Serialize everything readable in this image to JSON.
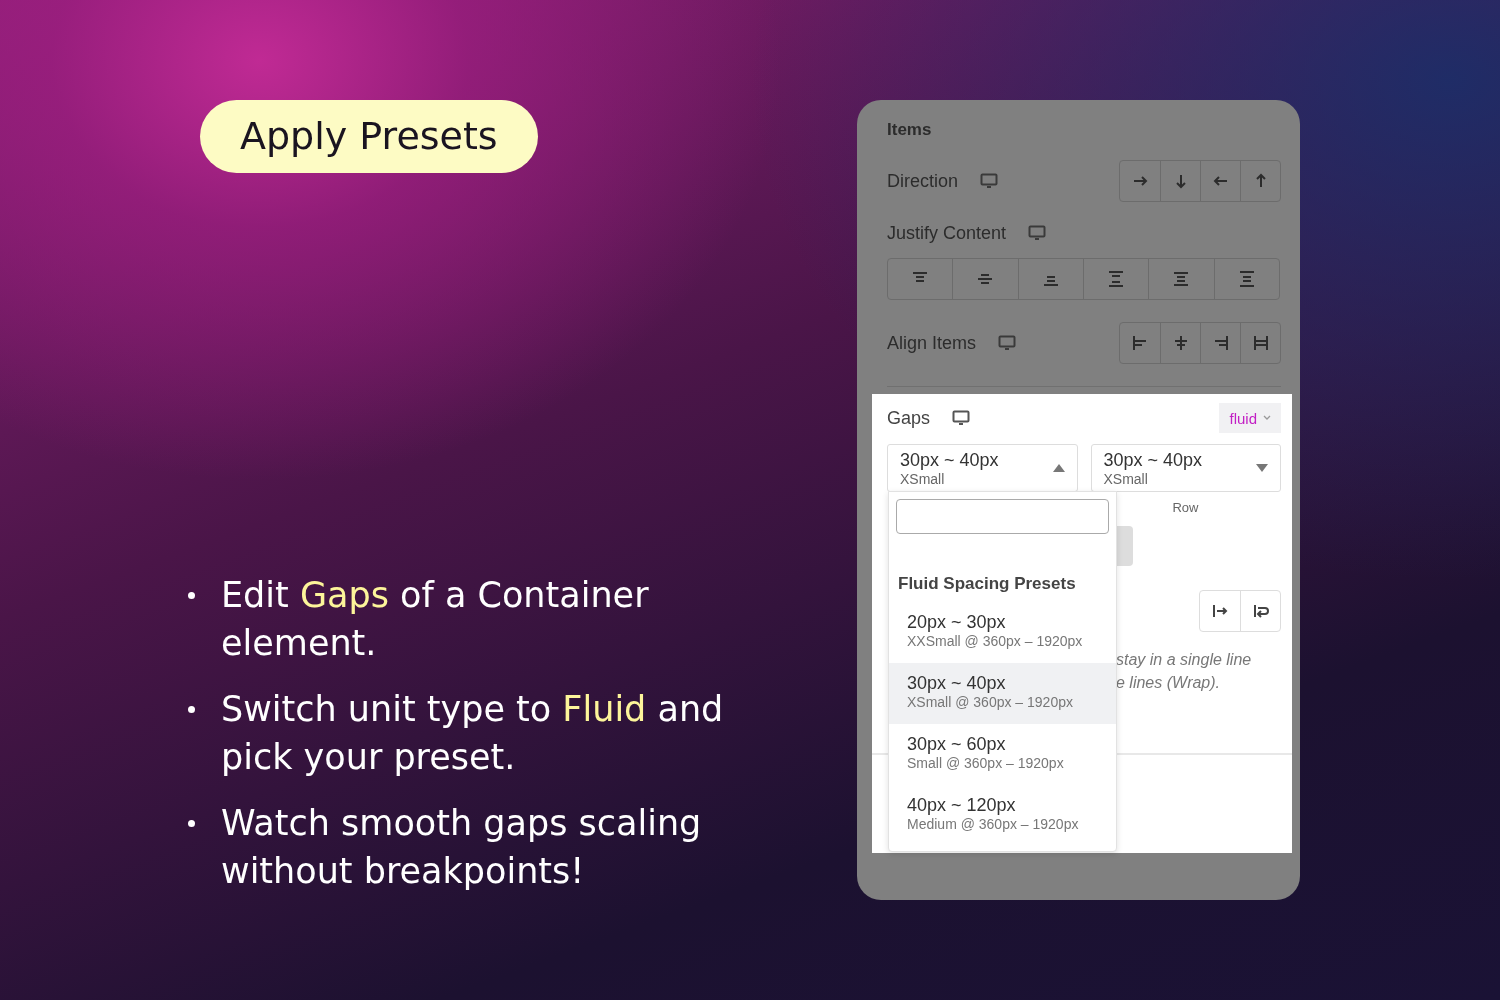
{
  "promo": {
    "title": "Apply Presets",
    "bullets": [
      "Edit **Gaps** of a Container element.",
      "Switch unit type to **Fluid** and pick your preset.",
      "Watch smooth gaps scaling without breakpoints!"
    ]
  },
  "panel": {
    "section_title": "Items",
    "direction": {
      "label": "Direction"
    },
    "justify_content": {
      "label": "Justify Content"
    },
    "align_items": {
      "label": "Align Items"
    },
    "gaps": {
      "label": "Gaps",
      "unit": "fluid",
      "selects": [
        {
          "value": "30px ~ 40px",
          "size": "XSmall",
          "open": true
        },
        {
          "value": "30px ~ 40px",
          "size": "XSmall",
          "open": false
        }
      ],
      "row_caption": "Row",
      "wrap_hint": [
        "stay in a single line",
        "e lines (Wrap)."
      ]
    },
    "dropdown": {
      "group_title": "Fluid Spacing Presets",
      "options": [
        {
          "range": "20px ~ 30px",
          "detail": "XXSmall @ 360px – 1920px",
          "selected": false
        },
        {
          "range": "30px ~ 40px",
          "detail": "XSmall @ 360px – 1920px",
          "selected": true
        },
        {
          "range": "30px ~ 60px",
          "detail": "Small @ 360px – 1920px",
          "selected": false
        },
        {
          "range": "40px ~ 120px",
          "detail": "Medium @ 360px – 1920px",
          "selected": false
        }
      ]
    }
  }
}
